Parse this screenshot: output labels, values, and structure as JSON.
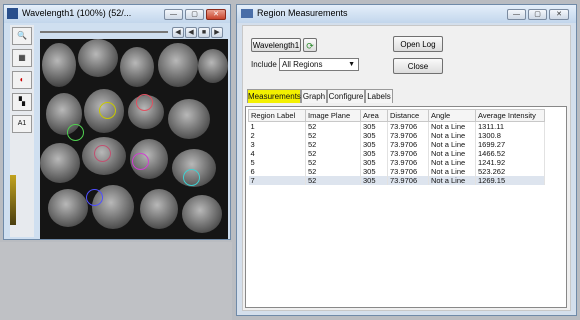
{
  "image_window": {
    "title": "Wavelength1 (100%) (52/...",
    "buttons": [
      "—",
      "▢",
      "✕"
    ],
    "nav": [
      "◀",
      "◀",
      "■",
      "▶"
    ]
  },
  "region_window": {
    "title": "Region Measurements",
    "buttons": [
      "—",
      "▢",
      "✕"
    ],
    "source_button": "Wavelength1",
    "open_log_button": "Open Log",
    "include_label": "Include",
    "include_value": "All Regions",
    "close_button": "Close",
    "tabs": [
      "Measurements",
      "Graph",
      "Configure",
      "Labels"
    ],
    "table": {
      "columns": [
        "Region Label",
        "Image Plane",
        "Area",
        "Distance",
        "Angle",
        "Average Intensity"
      ],
      "rows": [
        [
          "1",
          "52",
          "305",
          "73.9706",
          "Not a Line",
          "1311.11"
        ],
        [
          "2",
          "52",
          "305",
          "73.9706",
          "Not a Line",
          "1300.8"
        ],
        [
          "3",
          "52",
          "305",
          "73.9706",
          "Not a Line",
          "1699.27"
        ],
        [
          "4",
          "52",
          "305",
          "73.9706",
          "Not a Line",
          "1466.52"
        ],
        [
          "5",
          "52",
          "305",
          "73.9706",
          "Not a Line",
          "1241.92"
        ],
        [
          "6",
          "52",
          "305",
          "73.9706",
          "Not a Line",
          "523.262"
        ],
        [
          "7",
          "52",
          "305",
          "73.9706",
          "Not a Line",
          "1269.15"
        ]
      ]
    }
  },
  "colors": {
    "roi_1": "#c8c800",
    "roi_2": "#e05060",
    "roi_3": "#50d050",
    "roi_4": "#c05070",
    "roi_5": "#d040d0",
    "roi_6": "#40d0d0",
    "roi_7": "#5050ff",
    "active_tab": "#f3f000"
  }
}
